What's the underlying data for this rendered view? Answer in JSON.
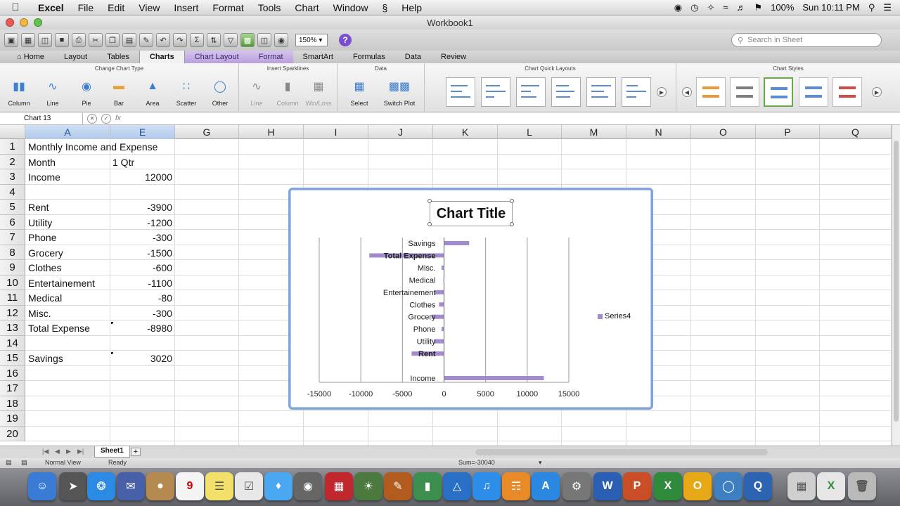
{
  "menubar": {
    "items": [
      "Excel",
      "File",
      "Edit",
      "View",
      "Insert",
      "Format",
      "Tools",
      "Chart",
      "Window",
      "Help"
    ],
    "battery": "100%",
    "clock": "Sun 10:11 PM"
  },
  "window": {
    "title": "Workbook1"
  },
  "toolbar": {
    "zoom": "150%",
    "search_placeholder": "Search in Sheet"
  },
  "ribbon": {
    "tabs": [
      "Home",
      "Layout",
      "Tables",
      "Charts",
      "Chart Layout",
      "Format",
      "SmartArt",
      "Formulas",
      "Data",
      "Review"
    ],
    "active_tab": "Charts",
    "groups": {
      "change_chart_type": "Change Chart Type",
      "insert_sparklines": "Insert Sparklines",
      "data": "Data",
      "chart_quick_layouts": "Chart Quick Layouts",
      "chart_styles": "Chart Styles"
    },
    "chart_types": [
      "Column",
      "Line",
      "Pie",
      "Bar",
      "Area",
      "Scatter",
      "Other"
    ],
    "sparklines": [
      "Line",
      "Column",
      "Win/Loss"
    ],
    "data_buttons": [
      "Select",
      "Switch Plot"
    ]
  },
  "formula_bar": {
    "name_box": "Chart 13",
    "fx": "fx"
  },
  "grid": {
    "columns": [
      "A",
      "E",
      "G",
      "H",
      "I",
      "J",
      "K",
      "L",
      "M",
      "N",
      "O",
      "P",
      "Q"
    ],
    "rows": [
      "1",
      "2",
      "3",
      "4",
      "5",
      "6",
      "7",
      "8",
      "9",
      "10",
      "11",
      "12",
      "13",
      "14",
      "15",
      "16",
      "17",
      "18",
      "19",
      "20"
    ],
    "cells": [
      {
        "row": 1,
        "a": "Monthly Income and Expense",
        "e": ""
      },
      {
        "row": 2,
        "a": "Month",
        "e": "1 Qtr"
      },
      {
        "row": 3,
        "a": "Income",
        "e": "12000"
      },
      {
        "row": 5,
        "a": "Rent",
        "e": "-3900"
      },
      {
        "row": 6,
        "a": "Utility",
        "e": "-1200"
      },
      {
        "row": 7,
        "a": "Phone",
        "e": "-300"
      },
      {
        "row": 8,
        "a": "Grocery",
        "e": "-1500"
      },
      {
        "row": 9,
        "a": "Clothes",
        "e": "-600"
      },
      {
        "row": 10,
        "a": "Entertainement",
        "e": "-1100"
      },
      {
        "row": 11,
        "a": "Medical",
        "e": "-80"
      },
      {
        "row": 12,
        "a": "Misc.",
        "e": "-300"
      },
      {
        "row": 13,
        "a": "Total Expense",
        "e": "-8980"
      },
      {
        "row": 15,
        "a": "Savings",
        "e": "3020"
      }
    ]
  },
  "chart_data": {
    "type": "bar",
    "orientation": "horizontal",
    "title": "Chart Title",
    "categories": [
      "Income",
      "Rent",
      "Utility",
      "Phone",
      "Grocery",
      "Clothes",
      "Entertainement",
      "Medical",
      "Misc.",
      "Total Expense",
      "Savings"
    ],
    "series": [
      {
        "name": "Series4",
        "values": [
          12000,
          -3900,
          -1200,
          -300,
          -1500,
          -600,
          -1100,
          -80,
          -300,
          -8980,
          3020
        ]
      }
    ],
    "xlim": [
      -15000,
      15000
    ],
    "xticks": [
      "-15000",
      "-10000",
      "-5000",
      "0",
      "5000",
      "10000",
      "15000"
    ],
    "grid": true,
    "legend": "right",
    "bar_color": "#a48bce"
  },
  "sheets": {
    "tabs": [
      "Sheet1"
    ],
    "add": "+"
  },
  "status": {
    "view": "Normal View",
    "state": "Ready",
    "sum": "Sum=-30040"
  }
}
